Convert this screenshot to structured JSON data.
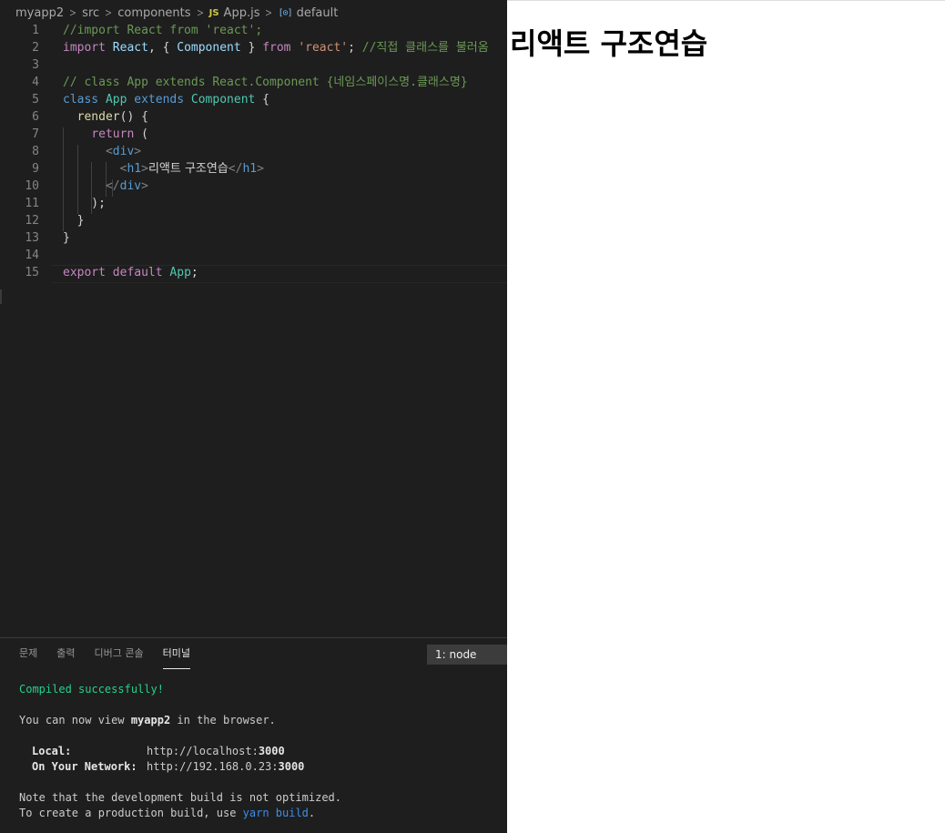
{
  "breadcrumb": {
    "items": [
      "myapp2",
      "src",
      "components",
      "App.js",
      "default"
    ],
    "js_badge": "JS",
    "symbol_icon": "[⊙]",
    "separator": ">"
  },
  "editor": {
    "lines": [
      {
        "num": "1",
        "tokens": [
          {
            "c": "t-comment",
            "t": "//import React from 'react';"
          }
        ]
      },
      {
        "num": "2",
        "tokens": [
          {
            "c": "t-kw",
            "t": "import "
          },
          {
            "c": "t-var",
            "t": "React"
          },
          {
            "c": "t-punc",
            "t": ", { "
          },
          {
            "c": "t-var",
            "t": "Component"
          },
          {
            "c": "t-punc",
            "t": " } "
          },
          {
            "c": "t-kw",
            "t": "from "
          },
          {
            "c": "t-str",
            "t": "'react'"
          },
          {
            "c": "t-punc",
            "t": "; "
          },
          {
            "c": "t-comment",
            "t": "//직접 클래스를 불러옴"
          }
        ]
      },
      {
        "num": "3",
        "tokens": []
      },
      {
        "num": "4",
        "tokens": [
          {
            "c": "t-comment",
            "t": "// class App extends React.Component {네임스페이스명.클래스명}"
          }
        ]
      },
      {
        "num": "5",
        "tokens": [
          {
            "c": "t-kwb",
            "t": "class "
          },
          {
            "c": "t-cls",
            "t": "App "
          },
          {
            "c": "t-kwb",
            "t": "extends "
          },
          {
            "c": "t-cls",
            "t": "Component"
          },
          {
            "c": "t-punc",
            "t": " {"
          }
        ]
      },
      {
        "num": "6",
        "tokens": [
          {
            "c": "t-punc",
            "t": "  "
          },
          {
            "c": "t-fn",
            "t": "render"
          },
          {
            "c": "t-punc",
            "t": "() {"
          }
        ]
      },
      {
        "num": "7",
        "tokens": [
          {
            "c": "t-punc",
            "t": "    "
          },
          {
            "c": "t-kw",
            "t": "return"
          },
          {
            "c": "t-punc",
            "t": " ("
          }
        ]
      },
      {
        "num": "8",
        "tokens": [
          {
            "c": "t-punc",
            "t": "      "
          },
          {
            "c": "t-tagb",
            "t": "<"
          },
          {
            "c": "t-tag",
            "t": "div"
          },
          {
            "c": "t-tagb",
            "t": ">"
          }
        ]
      },
      {
        "num": "9",
        "tokens": [
          {
            "c": "t-punc",
            "t": "        "
          },
          {
            "c": "t-tagb",
            "t": "<"
          },
          {
            "c": "t-tag",
            "t": "h1"
          },
          {
            "c": "t-tagb",
            "t": ">"
          },
          {
            "c": "t-text",
            "t": "리액트 구조연습"
          },
          {
            "c": "t-tagb",
            "t": "</"
          },
          {
            "c": "t-tag",
            "t": "h1"
          },
          {
            "c": "t-tagb",
            "t": ">"
          }
        ]
      },
      {
        "num": "10",
        "tokens": [
          {
            "c": "t-punc",
            "t": "      "
          },
          {
            "c": "t-tagb",
            "t": "</"
          },
          {
            "c": "t-tag",
            "t": "div"
          },
          {
            "c": "t-tagb",
            "t": ">"
          }
        ]
      },
      {
        "num": "11",
        "tokens": [
          {
            "c": "t-punc",
            "t": "    );"
          }
        ]
      },
      {
        "num": "12",
        "tokens": [
          {
            "c": "t-punc",
            "t": "  }"
          }
        ]
      },
      {
        "num": "13",
        "tokens": [
          {
            "c": "t-punc",
            "t": "}"
          }
        ]
      },
      {
        "num": "14",
        "tokens": []
      },
      {
        "num": "15",
        "tokens": [
          {
            "c": "t-kw",
            "t": "export "
          },
          {
            "c": "t-kw",
            "t": "default "
          },
          {
            "c": "t-cls",
            "t": "App"
          },
          {
            "c": "t-punc",
            "t": ";"
          }
        ]
      }
    ]
  },
  "panel": {
    "tabs": [
      {
        "label": "문제",
        "active": false
      },
      {
        "label": "출력",
        "active": false
      },
      {
        "label": "디버그 콘솔",
        "active": false
      },
      {
        "label": "터미널",
        "active": true
      }
    ],
    "terminal_select": "1: node"
  },
  "terminal": {
    "compiled": "Compiled successfully!",
    "view_prefix": "You can now view ",
    "app_name": "myapp2",
    "view_suffix": " in the browser.",
    "local_label": "Local:",
    "local_url_prefix": "http://localhost:",
    "local_port": "3000",
    "network_label": "On Your Network:",
    "network_url_prefix": "http://192.168.0.23:",
    "network_port": "3000",
    "note_line": "Note that the development build is not optimized.",
    "prod_prefix": "To create a production build, use ",
    "prod_cmd": "yarn build",
    "prod_suffix": "."
  },
  "browser": {
    "heading": "리액트 구조연습"
  },
  "colors": {
    "editor_bg": "#1e1e1e",
    "comment": "#6a9955",
    "keyword": "#c586c0",
    "class": "#4ec9b0",
    "terminal_green": "#23d18b",
    "terminal_blue": "#3b8eea"
  }
}
